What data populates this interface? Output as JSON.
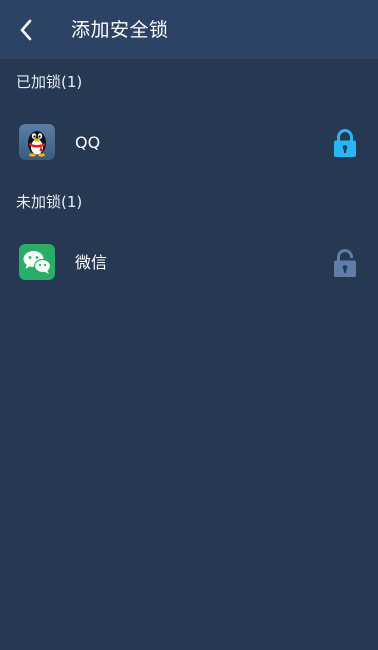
{
  "header": {
    "title": "添加安全锁",
    "back_icon": "chevron-left-icon"
  },
  "sections": {
    "locked": {
      "label": "已加锁(1)",
      "items": [
        {
          "name": "QQ",
          "icon": "qq-penguin-icon",
          "lock_state": "locked",
          "lock_color": "#29b6f6"
        }
      ]
    },
    "unlocked": {
      "label": "未加锁(1)",
      "items": [
        {
          "name": "微信",
          "icon": "wechat-icon",
          "lock_state": "unlocked",
          "lock_color": "#5f7ea8"
        }
      ]
    }
  },
  "colors": {
    "background": "#263852",
    "header": "#2d4366",
    "accent": "#29b6f6",
    "wechat_green": "#2aae67"
  }
}
